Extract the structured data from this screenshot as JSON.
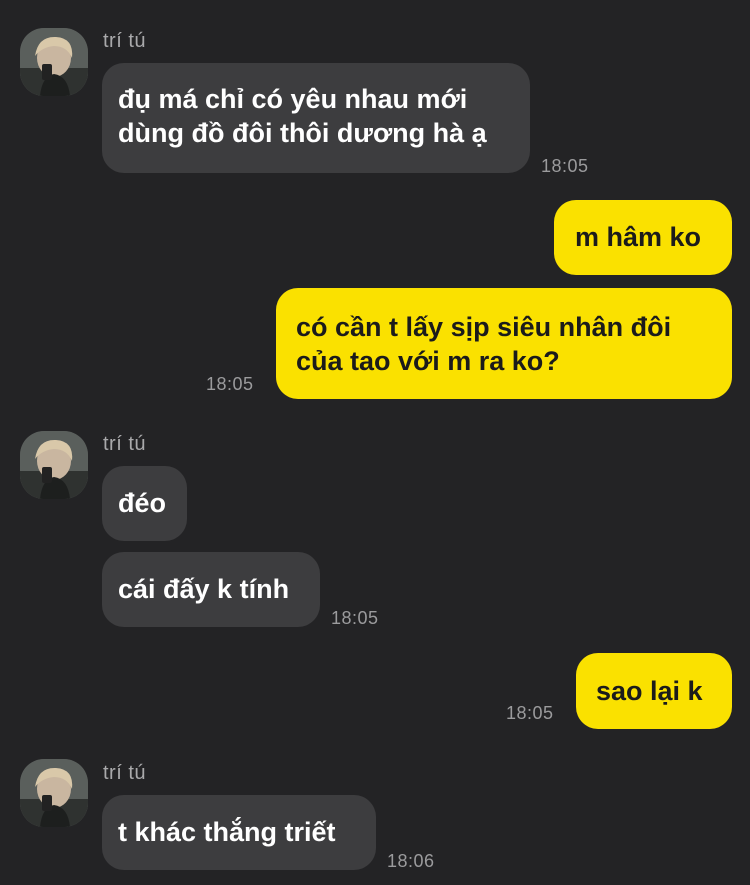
{
  "sender_name": "trí tú",
  "messages": [
    {
      "lines": [
        "đụ má chỉ có yêu nhau mới",
        "dùng đồ đôi thôi dương hà ạ"
      ],
      "time": "18:05"
    },
    {
      "lines": [
        "m hâm ko"
      ]
    },
    {
      "lines": [
        "có cần t lấy sịp siêu nhân đôi",
        "của tao với m ra ko?"
      ],
      "time": "18:05"
    },
    {
      "lines": [
        "đéo"
      ]
    },
    {
      "lines": [
        "cái đấy k tính"
      ],
      "time": "18:05"
    },
    {
      "lines": [
        "sao lại k"
      ],
      "time": "18:05"
    },
    {
      "lines": [
        "t khác thắng triết"
      ],
      "time": "18:06"
    }
  ],
  "colors": {
    "background": "#232325",
    "incoming_bubble": "#3d3d3f",
    "outgoing_bubble": "#fae100",
    "incoming_text": "#ffffff",
    "outgoing_text": "#1b1b1b",
    "timestamp": "#9b9b9d",
    "sender_name": "#a9a9ab"
  }
}
